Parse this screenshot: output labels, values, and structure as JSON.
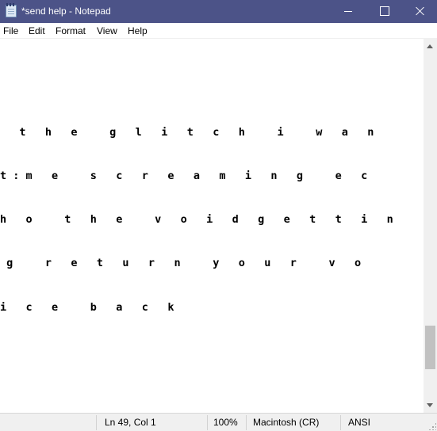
{
  "window": {
    "title": "*send help - Notepad",
    "icon": "notepad-icon",
    "accent_color": "#4c5388"
  },
  "menu": {
    "file": "File",
    "edit": "Edit",
    "format": "Format",
    "view": "View",
    "help": "Help"
  },
  "editor": {
    "lines": [
      "   t   h   e     g   l   i   t   c   h     i     w   a   n",
      "t : m   e     s   c   r   e   a   m   i   n   g     e   c",
      "h   o     t   h   e     v   o   i   d   g   e   t   t   i   n",
      " g     r   e   t   u   r   n     y   o   u   r     v   o",
      "i   c   e     b   a   c   k"
    ]
  },
  "status": {
    "position": "Ln 49, Col 1",
    "zoom": "100%",
    "line_ending": "Macintosh (CR)",
    "encoding": "ANSI"
  }
}
